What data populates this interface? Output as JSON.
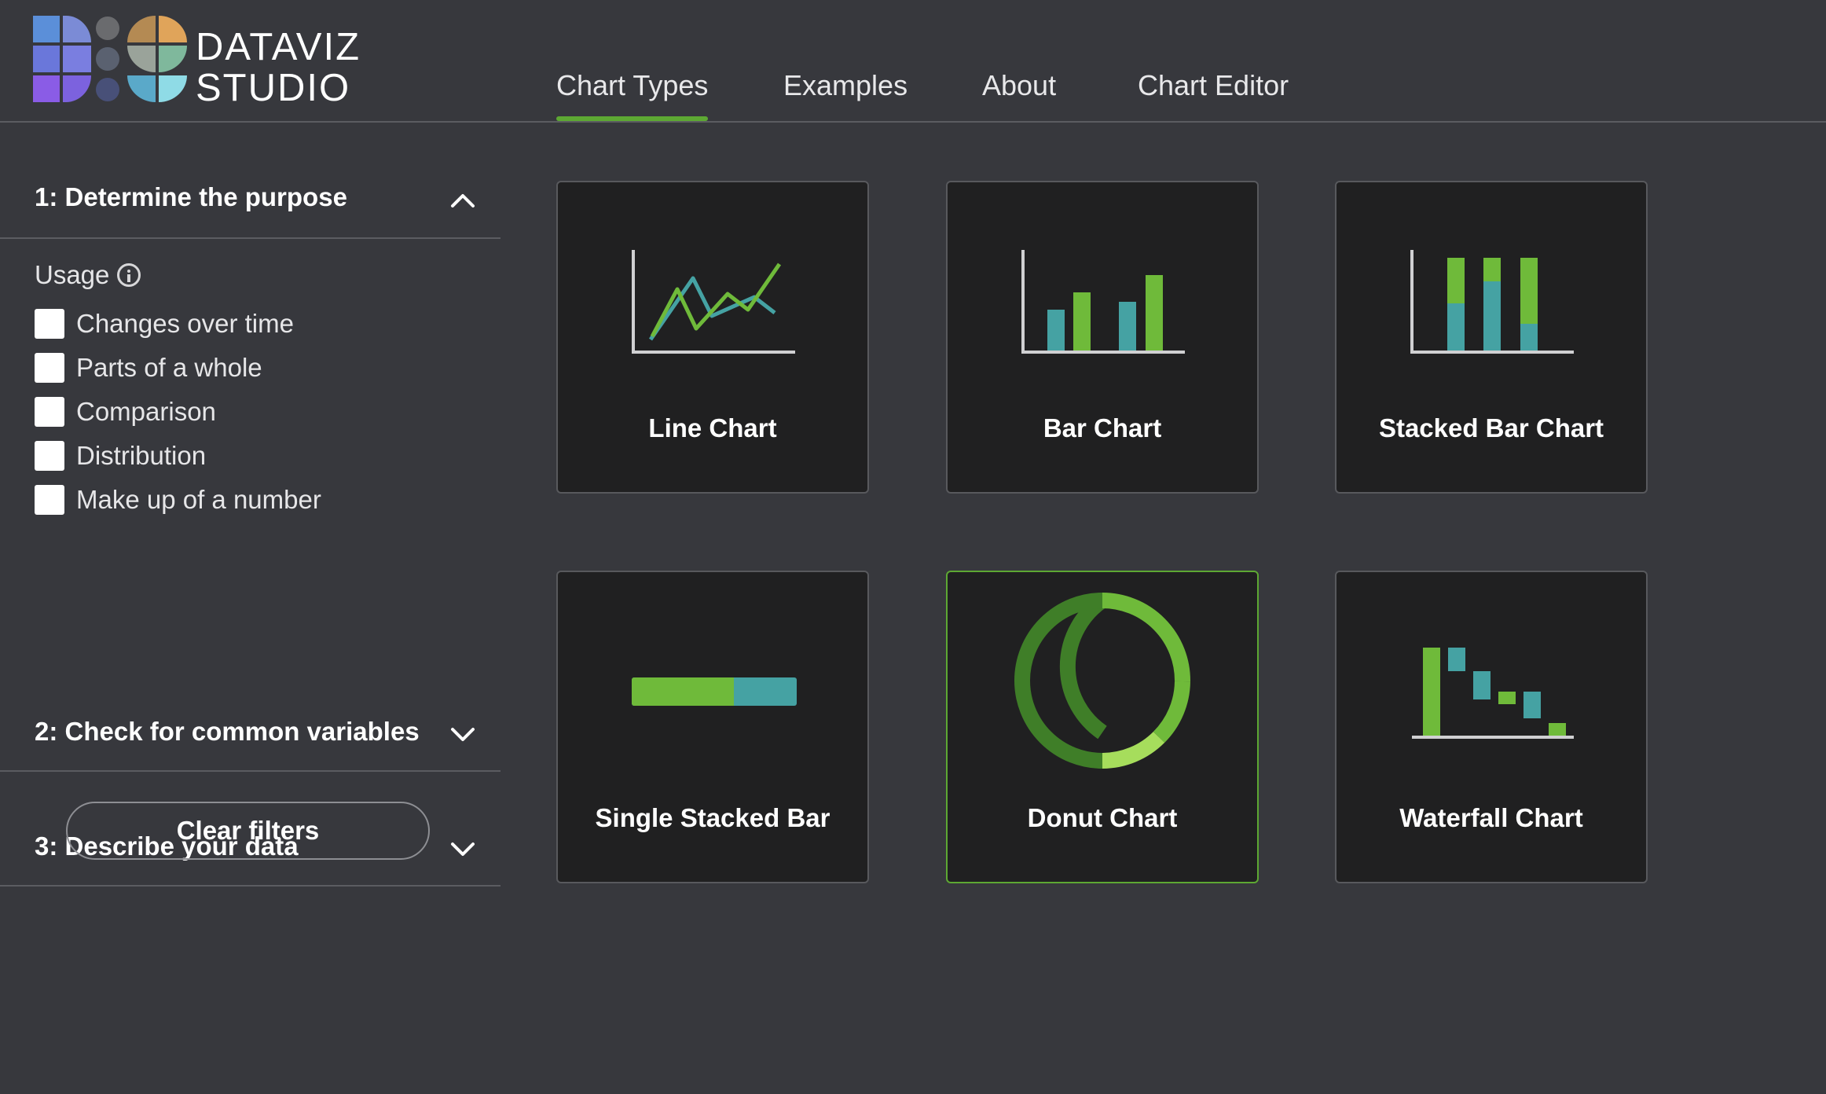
{
  "app": {
    "logo_line1": "DATAVIZ",
    "logo_line2": "STUDIO"
  },
  "nav": {
    "tabs": [
      {
        "label": "Chart Types",
        "active": true
      },
      {
        "label": "Examples",
        "active": false
      },
      {
        "label": "About",
        "active": false
      },
      {
        "label": "Chart Editor",
        "active": false
      }
    ]
  },
  "sidebar": {
    "sections": [
      {
        "title": "1: Determine the purpose",
        "expanded": true
      },
      {
        "title": "2: Check for common variables",
        "expanded": false
      },
      {
        "title": "3: Describe your data",
        "expanded": false
      }
    ],
    "usage": {
      "label": "Usage",
      "info_icon": "info-icon",
      "options": [
        {
          "label": "Changes over time",
          "checked": false
        },
        {
          "label": "Parts of a whole",
          "checked": false
        },
        {
          "label": "Comparison",
          "checked": false
        },
        {
          "label": "Distribution",
          "checked": false
        },
        {
          "label": "Make up of a number",
          "checked": false
        }
      ]
    },
    "clear_label": "Clear filters"
  },
  "cards": [
    {
      "label": "Line Chart",
      "icon": "line-chart-icon",
      "selected": false
    },
    {
      "label": "Bar Chart",
      "icon": "bar-chart-icon",
      "selected": false
    },
    {
      "label": "Stacked Bar Chart",
      "icon": "stacked-bar-chart-icon",
      "selected": false
    },
    {
      "label": "Single Stacked Bar",
      "icon": "single-stacked-bar-icon",
      "selected": false
    },
    {
      "label": "Donut Chart",
      "icon": "donut-chart-icon",
      "selected": true
    },
    {
      "label": "Waterfall Chart",
      "icon": "waterfall-chart-icon",
      "selected": false
    }
  ],
  "colors": {
    "background": "#37383d",
    "card": "#202021",
    "accent_green": "#5da833",
    "light_green": "#6fba3a",
    "teal": "#45a2a3",
    "axis": "#d0d0d2"
  }
}
